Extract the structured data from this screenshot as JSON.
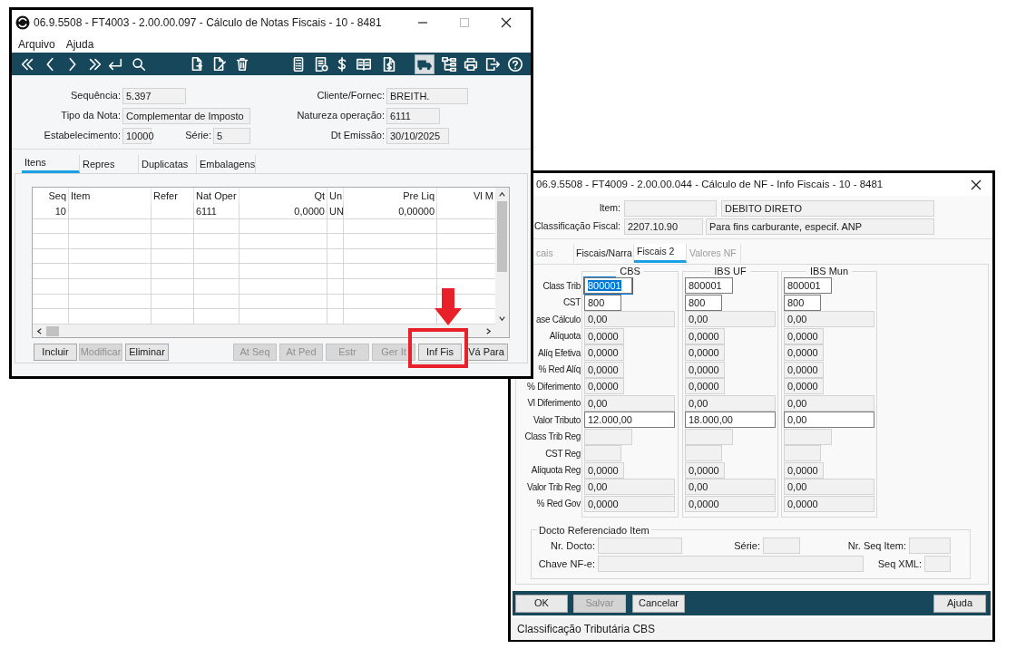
{
  "main_window": {
    "title": "06.9.5508 - FT4003 - 2.00.00.097 - Cálculo de Notas Fiscais - 10 - 8481",
    "menu": [
      {
        "label": "Arquivo"
      },
      {
        "label": "Ajuda"
      }
    ],
    "toolbar": [
      {
        "selected": false
      },
      {
        "selected": false
      },
      {
        "selected": false
      },
      {
        "selected": false
      },
      {
        "selected": false
      },
      {
        "selected": false
      },
      {
        "selected": false
      },
      {
        "selected": false
      },
      {
        "selected": false
      },
      {
        "selected": false
      },
      {
        "selected": false
      },
      {
        "selected": false
      },
      {
        "selected": false
      },
      {
        "selected": false
      },
      {
        "selected": true
      },
      {
        "selected": false
      },
      {
        "selected": false
      },
      {
        "selected": false
      },
      {
        "selected": false
      }
    ],
    "header": {
      "sequence": {
        "label": "Sequência:",
        "value": "5.397"
      },
      "client": {
        "label": "Cliente/Fornec:",
        "value": "BREITH."
      },
      "note_type": {
        "label": "Tipo da Nota:",
        "value": "Complementar de Imposto"
      },
      "operation_nature": {
        "label": "Natureza operação:",
        "value": "6111"
      },
      "establishment": {
        "label": "Estabelecimento:",
        "value": "10000"
      },
      "series": {
        "label": "Série:",
        "value": "5"
      },
      "issue_date": {
        "label": "Dt Emissão:",
        "value": "30/10/2025"
      }
    },
    "tabs": [
      {
        "label": "Itens",
        "selected": true
      },
      {
        "label": "Repres",
        "selected": false
      },
      {
        "label": "Duplicatas",
        "selected": false
      },
      {
        "label": "Embalagens",
        "selected": false
      }
    ],
    "grid": {
      "columns": [
        {
          "label": "Seq"
        },
        {
          "label": "Item"
        },
        {
          "label": "Refer"
        },
        {
          "label": "Nat Oper"
        },
        {
          "label": "Qt"
        },
        {
          "label": "Un"
        },
        {
          "label": "Pre Liq"
        },
        {
          "label": "Vl M"
        }
      ],
      "rows": [
        [
          "10",
          null,
          null,
          "6111",
          "0,0000",
          "UN",
          "0,00000",
          null
        ]
      ]
    },
    "buttons": [
      {
        "label": "Incluir",
        "disabled": false
      },
      {
        "label": "Modificar",
        "disabled": true
      },
      {
        "label": "Eliminar",
        "disabled": false
      },
      {
        "label": "At Seq",
        "disabled": true
      },
      {
        "label": "At Ped",
        "disabled": true
      },
      {
        "label": "Estr",
        "disabled": true
      },
      {
        "label": "Ger It",
        "disabled": true
      },
      {
        "label": "Inf Fis",
        "disabled": false
      },
      {
        "label": "Vá Para",
        "disabled": false
      }
    ]
  },
  "detail_window": {
    "title": "06.9.5508 - FT4009 - 2.00.00.044 - Cálculo de NF - Info Fiscais - 10 - 8481",
    "item": {
      "label": "Item:",
      "description": "DEBITO DIRETO"
    },
    "fiscal_class": {
      "label": "Classificação Fiscal:",
      "code": "2207.10.90",
      "description": "Para fins carburante, especif. ANP"
    },
    "tabs": [
      {
        "label": "cais",
        "selected": false,
        "disabled": true
      },
      {
        "label": "Fiscais/Narra",
        "selected": false,
        "disabled": false
      },
      {
        "label": "Fiscais 2",
        "selected": true,
        "disabled": false
      },
      {
        "label": "Valores NF",
        "selected": false,
        "disabled": true
      }
    ],
    "row_labels": [
      "Class Trib",
      "CST",
      "ase Cálculo",
      "Alíquota",
      "Alíq Efetiva",
      "% Red Alíq",
      "% Diferimento",
      "Vl Diferimento",
      "Valor Tributo",
      "Class Trib Reg",
      "CST Reg",
      "Alíquota Reg",
      "Valor Trib Reg",
      "% Red Gov"
    ],
    "groups": [
      {
        "title": "CBS",
        "fields": [
          {
            "value": "800001",
            "editable": true,
            "selected": true
          },
          {
            "value": "800",
            "editable": true,
            "selected": false
          },
          {
            "value": "0,00",
            "editable": false,
            "selected": false
          },
          {
            "value": "0,0000",
            "editable": false,
            "selected": false
          },
          {
            "value": "0,0000",
            "editable": false,
            "selected": false
          },
          {
            "value": "0,0000",
            "editable": false,
            "selected": false
          },
          {
            "value": "0,0000",
            "editable": false,
            "selected": false
          },
          {
            "value": "0,00",
            "editable": false,
            "selected": false
          },
          {
            "value": "12.000,00",
            "editable": true,
            "selected": false
          },
          {
            "editable": false,
            "selected": false
          },
          {
            "editable": false,
            "selected": false
          },
          {
            "value": "0,0000",
            "editable": false,
            "selected": false
          },
          {
            "value": "0,00",
            "editable": false,
            "selected": false
          },
          {
            "value": "0,0000",
            "editable": false,
            "selected": false
          }
        ]
      },
      {
        "title": "IBS UF",
        "fields": [
          {
            "value": "800001",
            "editable": true,
            "selected": false
          },
          {
            "value": "800",
            "editable": true,
            "selected": false
          },
          {
            "value": "0,00",
            "editable": false,
            "selected": false
          },
          {
            "value": "0,0000",
            "editable": false,
            "selected": false
          },
          {
            "value": "0,0000",
            "editable": false,
            "selected": false
          },
          {
            "value": "0,0000",
            "editable": false,
            "selected": false
          },
          {
            "value": "0,0000",
            "editable": false,
            "selected": false
          },
          {
            "value": "0,00",
            "editable": false,
            "selected": false
          },
          {
            "value": "18.000,00",
            "editable": true,
            "selected": false
          },
          {
            "editable": false,
            "selected": false
          },
          {
            "editable": false,
            "selected": false
          },
          {
            "value": "0,0000",
            "editable": false,
            "selected": false
          },
          {
            "value": "0,00",
            "editable": false,
            "selected": false
          },
          {
            "value": "0,0000",
            "editable": false,
            "selected": false
          }
        ]
      },
      {
        "title": "IBS Mun",
        "fields": [
          {
            "value": "800001",
            "editable": true,
            "selected": false
          },
          {
            "value": "800",
            "editable": true,
            "selected": false
          },
          {
            "value": "0,00",
            "editable": false,
            "selected": false
          },
          {
            "value": "0,0000",
            "editable": false,
            "selected": false
          },
          {
            "value": "0,0000",
            "editable": false,
            "selected": false
          },
          {
            "value": "0,0000",
            "editable": false,
            "selected": false
          },
          {
            "value": "0,0000",
            "editable": false,
            "selected": false
          },
          {
            "value": "0,00",
            "editable": false,
            "selected": false
          },
          {
            "value": "0,00",
            "editable": true,
            "selected": false
          },
          {
            "editable": false,
            "selected": false
          },
          {
            "editable": false,
            "selected": false
          },
          {
            "value": "0,0000",
            "editable": false,
            "selected": false
          },
          {
            "value": "0,00",
            "editable": false,
            "selected": false
          },
          {
            "value": "0,0000",
            "editable": false,
            "selected": false
          }
        ]
      }
    ],
    "reference": {
      "title": "Docto Referenciado Item",
      "fields": [
        {
          "label": "Nr. Docto:"
        },
        {
          "label": "Série:"
        },
        {
          "label": "Nr. Seq Item:"
        },
        {
          "label": "Chave NF-e:"
        },
        {
          "label": "Seq XML:"
        }
      ]
    },
    "buttons": [
      {
        "label": "OK",
        "disabled": false
      },
      {
        "label": "Salvar",
        "disabled": true
      },
      {
        "label": "Cancelar",
        "disabled": false
      },
      {
        "label": "Ajuda",
        "disabled": false
      }
    ],
    "status_bar": "Classificação Tributária CBS"
  }
}
